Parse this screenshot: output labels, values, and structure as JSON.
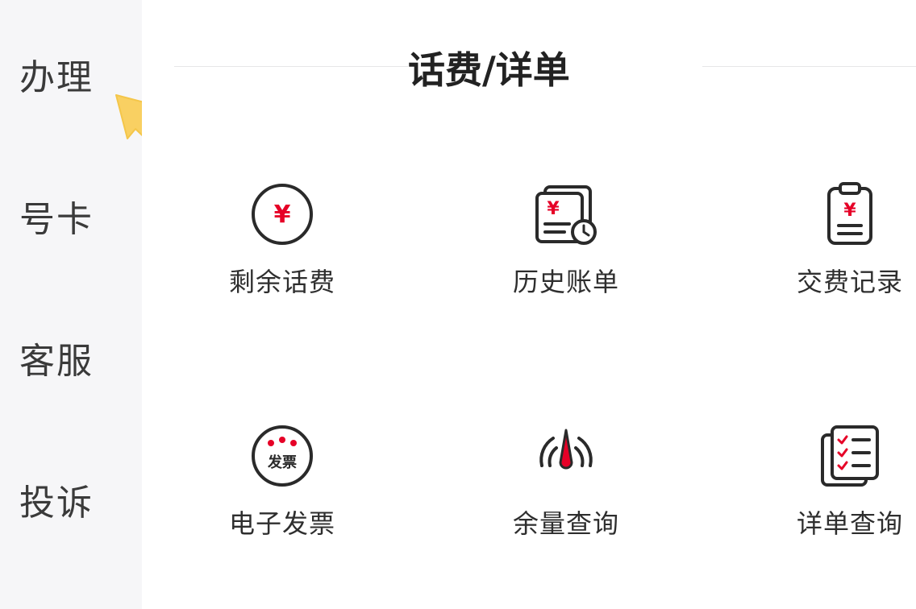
{
  "sidebar": {
    "items": [
      {
        "label": "办理"
      },
      {
        "label": "号卡"
      },
      {
        "label": "客服"
      },
      {
        "label": "投诉"
      }
    ]
  },
  "section": {
    "title": "话费/详单"
  },
  "grid": {
    "items": [
      {
        "label": "剩余话费",
        "icon": "yuan-circle-icon"
      },
      {
        "label": "历史账单",
        "icon": "bill-history-icon"
      },
      {
        "label": "交费记录",
        "icon": "payment-clipboard-icon"
      },
      {
        "label": "电子发票",
        "icon": "e-invoice-icon",
        "icon_text": "发票"
      },
      {
        "label": "余量查询",
        "icon": "balance-gauge-icon"
      },
      {
        "label": "详单查询",
        "icon": "detail-list-icon"
      }
    ]
  },
  "icon_glyphs": {
    "yuan": "¥"
  },
  "colors": {
    "accent": "#e60027",
    "icon_stroke": "#2a2a2a",
    "arrow": "#f9d062",
    "sidebar_bg": "#f6f6f8"
  }
}
